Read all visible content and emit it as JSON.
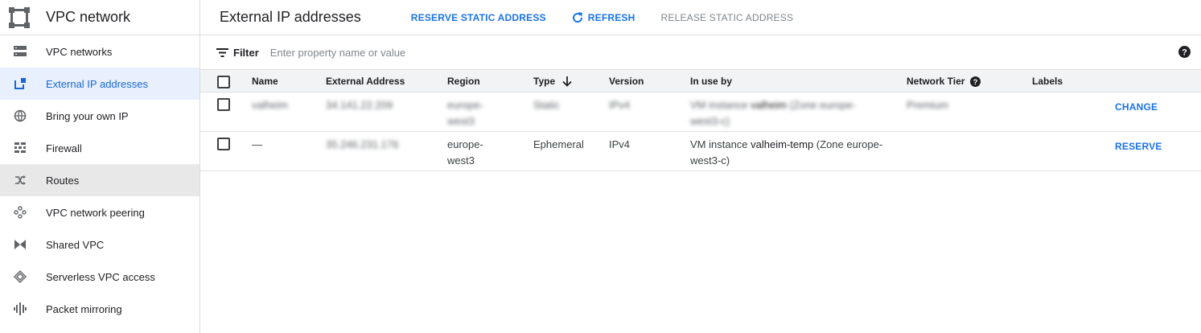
{
  "sidebar": {
    "title": "VPC network",
    "items": [
      {
        "label": "VPC networks",
        "icon": "vpc-networks-icon"
      },
      {
        "label": "External IP addresses",
        "icon": "external-ip-icon"
      },
      {
        "label": "Bring your own IP",
        "icon": "globe-icon"
      },
      {
        "label": "Firewall",
        "icon": "firewall-icon"
      },
      {
        "label": "Routes",
        "icon": "routes-icon"
      },
      {
        "label": "VPC network peering",
        "icon": "peering-icon"
      },
      {
        "label": "Shared VPC",
        "icon": "shared-vpc-icon"
      },
      {
        "label": "Serverless VPC access",
        "icon": "serverless-icon"
      },
      {
        "label": "Packet mirroring",
        "icon": "packet-mirroring-icon"
      }
    ],
    "active_index": 1,
    "hover_index": 4
  },
  "header": {
    "title": "External IP addresses",
    "reserve_label": "RESERVE STATIC ADDRESS",
    "refresh_label": "REFRESH",
    "release_label": "RELEASE STATIC ADDRESS"
  },
  "filter": {
    "label": "Filter",
    "placeholder": "Enter property name or value"
  },
  "table": {
    "columns": {
      "name": "Name",
      "address": "External Address",
      "region": "Region",
      "type": "Type",
      "version": "Version",
      "in_use_by": "In use by",
      "tier": "Network Tier",
      "labels": "Labels"
    },
    "rows": [
      {
        "name": "valheim",
        "address": "34.141.22.209",
        "region_1": "europe-",
        "region_2": "west3",
        "type": "Static",
        "version": "IPv4",
        "in_use_prefix": "VM instance ",
        "in_use_instance": "valheim",
        "in_use_suffix": " (Zone europe-",
        "in_use_line2": "west3-c)",
        "tier": "Premium",
        "action": "CHANGE"
      },
      {
        "name": "—",
        "address": "35.246.231.176",
        "region_1": "europe-",
        "region_2": "west3",
        "type": "Ephemeral",
        "version": "IPv4",
        "in_use_prefix": "VM instance ",
        "in_use_instance": "valheim-temp",
        "in_use_suffix": " (Zone europe-",
        "in_use_line2": "west3-c)",
        "tier": "",
        "action": "RESERVE"
      }
    ]
  },
  "colors": {
    "accent": "#1a73e8",
    "active_bg": "#e8f0fe",
    "header_bg": "#f1f3f4"
  }
}
